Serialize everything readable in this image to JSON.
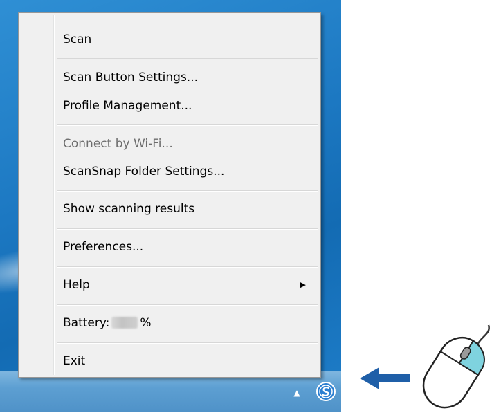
{
  "menu": {
    "items": [
      {
        "label": "Scan",
        "enabled": true
      },
      {
        "label": "Scan Button Settings...",
        "enabled": true
      },
      {
        "label": "Profile Management...",
        "enabled": true
      },
      {
        "label": "Connect by Wi-Fi...",
        "enabled": false
      },
      {
        "label": "ScanSnap Folder Settings...",
        "enabled": true
      },
      {
        "label": "Show scanning results",
        "enabled": true
      },
      {
        "label": "Preferences...",
        "enabled": true
      },
      {
        "label": "Help",
        "enabled": true,
        "has_submenu": true
      },
      {
        "label": "Battery:",
        "suffix": "%",
        "value_obscured": true,
        "enabled": true
      },
      {
        "label": "Exit",
        "enabled": true
      }
    ]
  },
  "taskbar": {
    "tray_icons": [
      "show-hidden-icons-arrow-icon",
      "scansnap-manager-icon"
    ]
  },
  "illustration": {
    "icons": [
      "left-arrow-icon",
      "mouse-right-click-icon"
    ],
    "accent_color": "#1f5fa8",
    "highlight_color": "#7fd3df"
  }
}
